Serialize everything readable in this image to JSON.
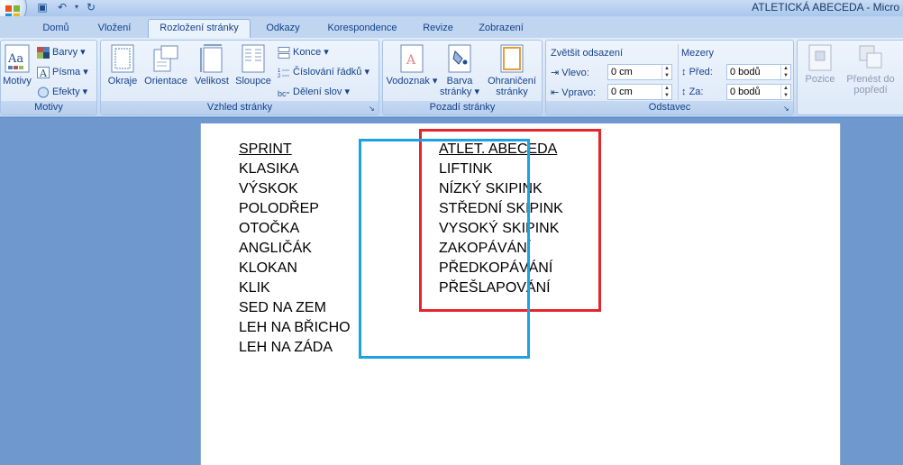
{
  "window": {
    "title": "ATLETICKÁ ABECEDA - Micro"
  },
  "tabs": [
    "Domů",
    "Vložení",
    "Rozložení stránky",
    "Odkazy",
    "Korespondence",
    "Revize",
    "Zobrazení"
  ],
  "ribbon": {
    "motivy": {
      "label": "Motivy",
      "big": "Motivy",
      "barvy": "Barvy",
      "pisma": "Písma",
      "efekty": "Efekty"
    },
    "vzhled": {
      "label": "Vzhled stránky",
      "okraje": "Okraje",
      "orientace": "Orientace",
      "velikost": "Velikost",
      "sloupce": "Sloupce",
      "konce": "Konce",
      "cislovani": "Číslování řádků",
      "deleni": "Dělení slov"
    },
    "pozadi": {
      "label": "Pozadí stránky",
      "vodoznak": "Vodoznak",
      "barva1": "Barva",
      "barva2": "stránky",
      "ohr1": "Ohraničení",
      "ohr2": "stránky"
    },
    "odstavec": {
      "label": "Odstavec",
      "odsazeni": "Zvětšit odsazení",
      "vlevo_label": "Vlevo:",
      "vlevo": "0 cm",
      "vpravo_label": "Vpravo:",
      "vpravo": "0 cm",
      "mezery": "Mezery",
      "pred_label": "Před:",
      "pred": "0 bodů",
      "za_label": "Za:",
      "za": "0 bodů"
    },
    "usporadat": {
      "pozice": "Pozice",
      "prenest1": "Přenést do",
      "prenest2": "popředí"
    }
  },
  "document": {
    "left_column": [
      "SPRINT",
      "KLASIKA",
      "VÝSKOK",
      "POLODŘEP",
      "OTOČKA",
      "ANGLIČÁK",
      "KLOKAN",
      "KLIK",
      "SED NA ZEM",
      "LEH NA BŘICHO",
      "LEH NA ZÁDA"
    ],
    "right_column": [
      "ATLET. ABECEDA",
      "LIFTINK",
      "NÍZKÝ SKIPINK",
      "STŘEDNÍ SKIPINK",
      "VYSOKÝ SKIPINK",
      "ZAKOPÁVÁNÍ",
      "PŘEDKOPÁVÁNÍ",
      "PŘEŠLAPOVÁNÍ"
    ]
  },
  "colors": {
    "blue_box": "#1aa3e0",
    "red_box": "#e5252c"
  }
}
